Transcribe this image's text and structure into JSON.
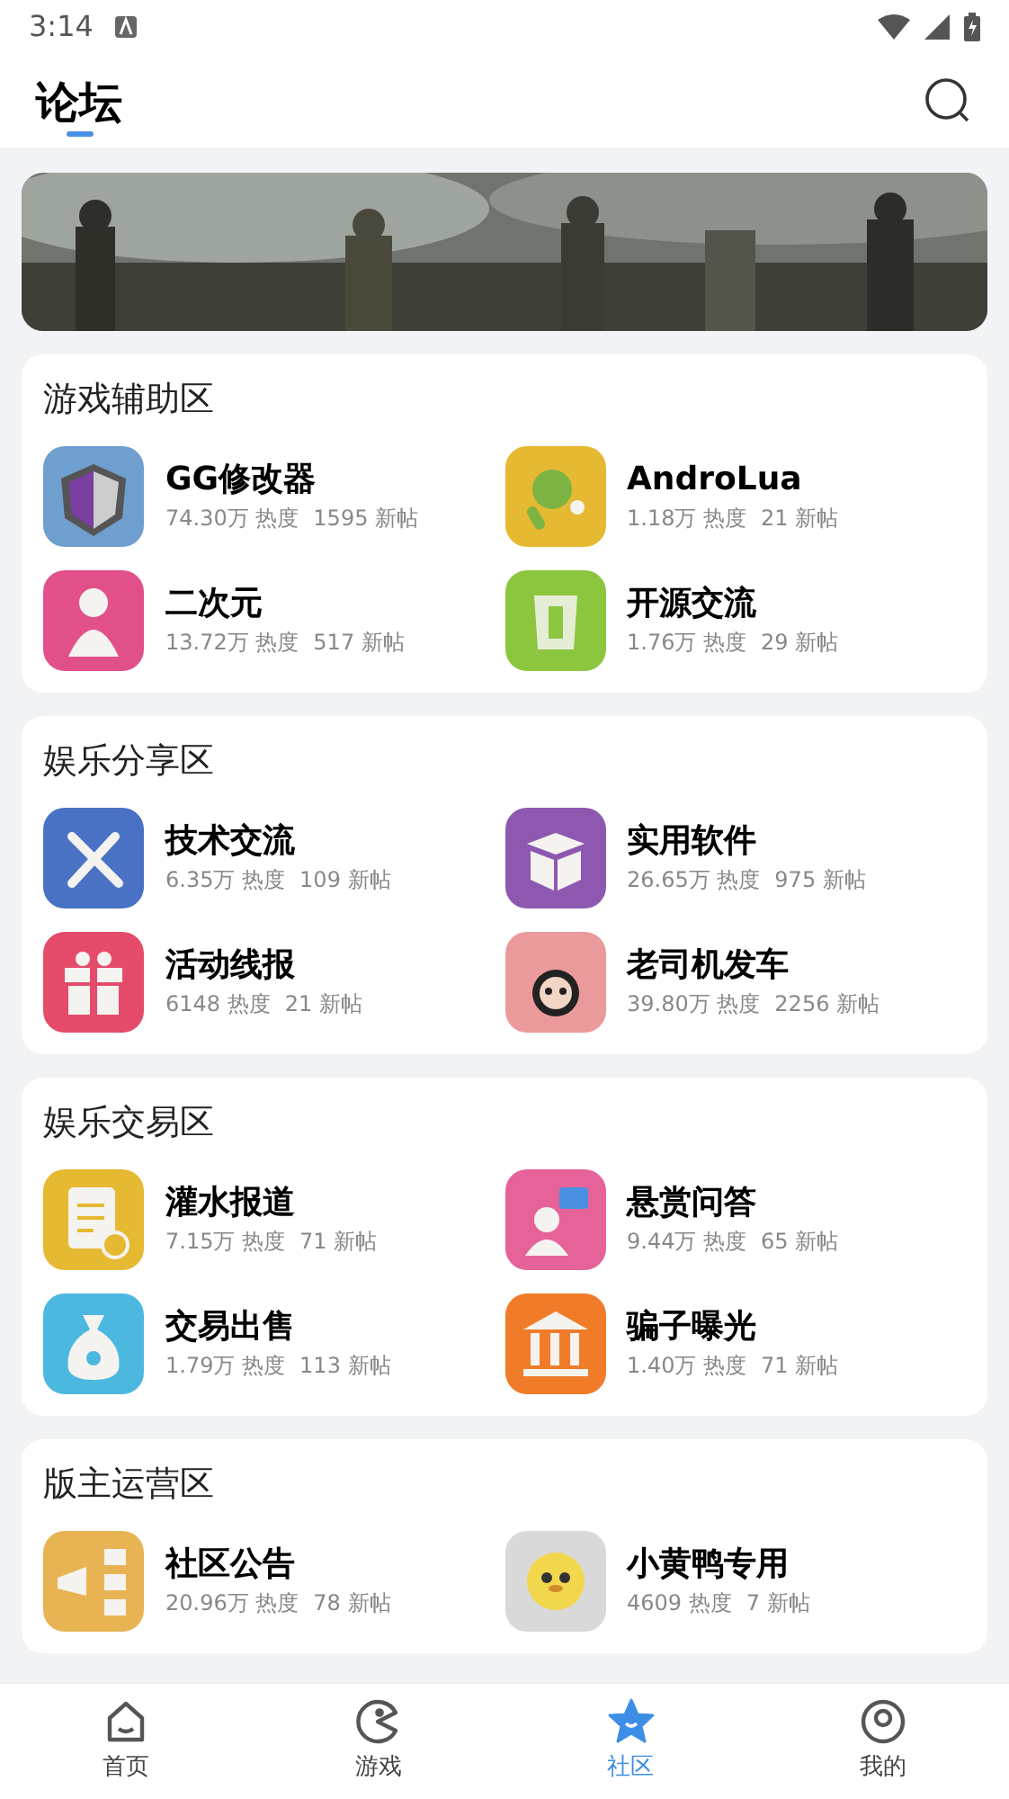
{
  "status_bar": {
    "time": "3:14"
  },
  "header": {
    "title": "论坛",
    "selected": true
  },
  "sections": [
    {
      "title": "游戏辅助区",
      "boards": [
        {
          "name": "GG修改器",
          "heat": "74.30万 热度",
          "posts": "1595 新帖",
          "kind": "gg",
          "color": "#6f9fcf"
        },
        {
          "name": "AndroLua",
          "heat": "1.18万 热度",
          "posts": "21 新帖",
          "kind": "android",
          "color": "#e6b932"
        },
        {
          "name": "二次元",
          "heat": "13.72万 热度",
          "posts": "517 新帖",
          "kind": "figure",
          "color": "#e2508a"
        },
        {
          "name": "开源交流",
          "heat": "1.76万 热度",
          "posts": "29 新帖",
          "kind": "brush",
          "color": "#8cc63f"
        }
      ]
    },
    {
      "title": "娱乐分享区",
      "boards": [
        {
          "name": "技术交流",
          "heat": "6.35万 热度",
          "posts": "109 新帖",
          "kind": "tools",
          "color": "#4a72c4"
        },
        {
          "name": "实用软件",
          "heat": "26.65万 热度",
          "posts": "975 新帖",
          "kind": "box",
          "color": "#8e58b0"
        },
        {
          "name": "活动线报",
          "heat": "6148 热度",
          "posts": "21 新帖",
          "kind": "gift",
          "color": "#e54b6a"
        },
        {
          "name": "老司机发车",
          "heat": "39.80万 热度",
          "posts": "2256 新帖",
          "kind": "meme",
          "color": "#ea9a9a"
        }
      ]
    },
    {
      "title": "娱乐交易区",
      "boards": [
        {
          "name": "灌水报道",
          "heat": "7.15万 热度",
          "posts": "71 新帖",
          "kind": "notes",
          "color": "#e6b932"
        },
        {
          "name": "悬赏问答",
          "heat": "9.44万 热度",
          "posts": "65 新帖",
          "kind": "question",
          "color": "#e6639a"
        },
        {
          "name": "交易出售",
          "heat": "1.79万 热度",
          "posts": "113 新帖",
          "kind": "money",
          "color": "#4cb8e0"
        },
        {
          "name": "骗子曝光",
          "heat": "1.40万 热度",
          "posts": "71 新帖",
          "kind": "bank",
          "color": "#f07c2a"
        }
      ]
    },
    {
      "title": "版主运营区",
      "boards": [
        {
          "name": "社区公告",
          "heat": "20.96万 热度",
          "posts": "78 新帖",
          "kind": "megaphone",
          "color": "#e8b453"
        },
        {
          "name": "小黄鸭专用",
          "heat": "4609 热度",
          "posts": "7 新帖",
          "kind": "duck",
          "color": "#d9d9d9"
        }
      ]
    }
  ],
  "nav": [
    {
      "label": "首页",
      "kind": "home",
      "selected": false
    },
    {
      "label": "游戏",
      "kind": "game",
      "selected": false
    },
    {
      "label": "社区",
      "kind": "star",
      "selected": true
    },
    {
      "label": "我的",
      "kind": "user",
      "selected": false
    }
  ]
}
